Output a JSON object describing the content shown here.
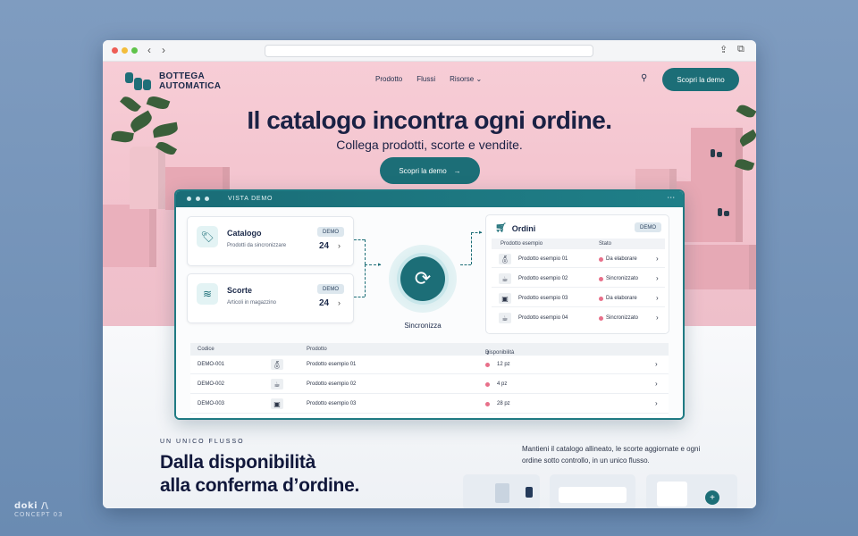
{
  "watermark": {
    "brand": "doki /\\",
    "concept": "CONCEPT 03"
  },
  "browser": {
    "back_icon": "chevron-left-icon",
    "forward_icon": "chevron-right-icon",
    "share_icon": "share-icon",
    "tabs_icon": "tabs-icon"
  },
  "site": {
    "logo_line1": "BOTTEGA",
    "logo_line2": "AUTOMATICA",
    "nav": [
      {
        "label": "Prodotto"
      },
      {
        "label": "Flussi"
      },
      {
        "label": "Risorse"
      }
    ],
    "cta_top": "Scopri la demo",
    "accent": "#1c6e77"
  },
  "hero": {
    "title": "Il catalogo incontra ogni ordine.",
    "subtitle": "Collega prodotti, scorte e vendite.",
    "cta": "Scopri la demo"
  },
  "demo": {
    "window_title": "VISTA DEMO",
    "cards": [
      {
        "title": "Catalogo",
        "subtitle": "Prodotti da sincronizzare",
        "badge": "DEMO",
        "count": "24",
        "icon": "tag-icon"
      },
      {
        "title": "Scorte",
        "subtitle": "Articoli in magazzino",
        "badge": "DEMO",
        "count": "24",
        "icon": "database-icon"
      }
    ],
    "sync_label": "Sincronizza",
    "orders": {
      "title": "Ordini",
      "badge": "DEMO",
      "col_product": "Prodotto esempio",
      "col_status": "Stato",
      "rows": [
        {
          "product": "Prodotto esempio 01",
          "status": "Da elaborare",
          "status_color": "#e8708a"
        },
        {
          "product": "Prodotto esempio 02",
          "status": "Sincronizzato",
          "status_color": "#e8708a"
        },
        {
          "product": "Prodotto esempio 03",
          "status": "Da elaborare",
          "status_color": "#e8708a"
        },
        {
          "product": "Prodotto esempio 04",
          "status": "Sincronizzato",
          "status_color": "#e8708a"
        }
      ]
    },
    "table": {
      "col_code": "Codice",
      "col_product": "Prodotto",
      "col_availability": "Disponibilità",
      "rows": [
        {
          "code": "DEMO-001",
          "product": "Prodotto esempio 01",
          "qty": "12 pz"
        },
        {
          "code": "DEMO-002",
          "product": "Prodotto esempio 02",
          "qty": "4 pz"
        },
        {
          "code": "DEMO-003",
          "product": "Prodotto esempio 03",
          "qty": "28 pz"
        }
      ]
    }
  },
  "lower": {
    "eyebrow": "UN UNICO FLUSSO",
    "title_line1": "Dalla disponibilità",
    "title_line2": "alla conferma d’ordine.",
    "text": "Mantieni il catalogo allineato, le scorte aggiornate e ogni ordine sotto controllo, in un unico flusso."
  }
}
